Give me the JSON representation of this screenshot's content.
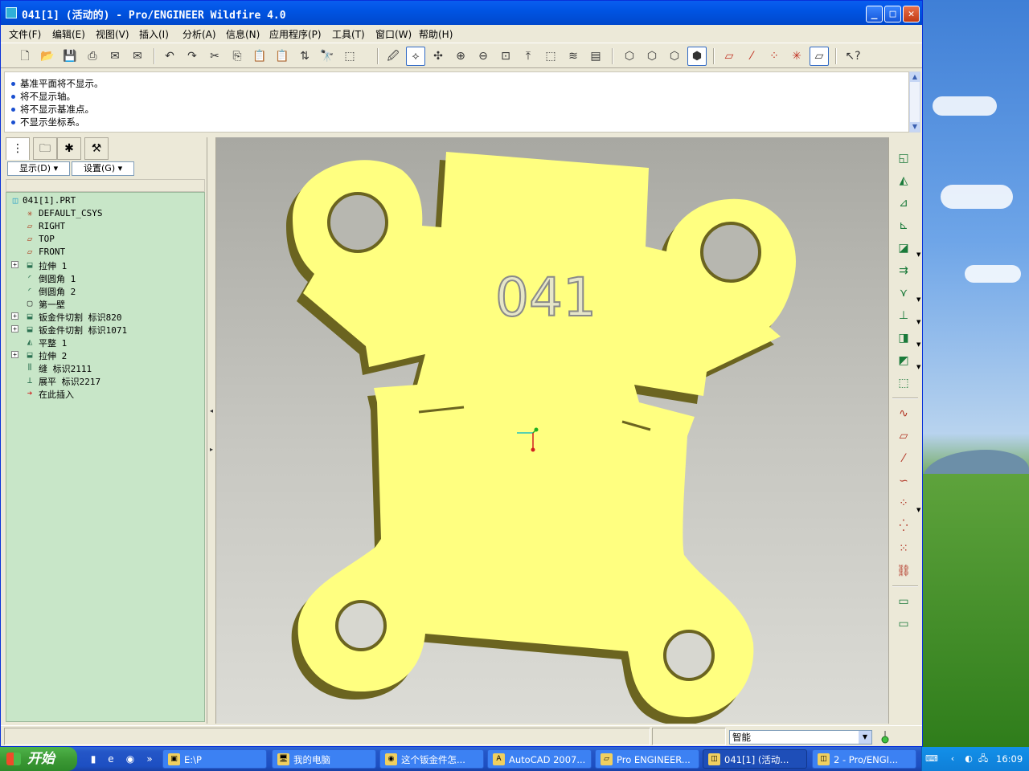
{
  "window": {
    "title": "041[1] (活动的) - Pro/ENGINEER Wildfire 4.0",
    "minimize": "_",
    "maximize": "□",
    "close": "✕"
  },
  "menus": [
    "文件(F)",
    "编辑(E)",
    "视图(V)",
    "插入(I)",
    "分析(A)",
    "信息(N)",
    "应用程序(P)",
    "工具(T)",
    "窗口(W)",
    "帮助(H)"
  ],
  "toolbar_icons": [
    "new-icon",
    "open-icon",
    "save-icon",
    "print-icon",
    "email-icon",
    "email-attach-icon",
    "undo-icon",
    "redo-icon",
    "cut-icon",
    "copy-icon",
    "paste-icon",
    "paste-special-icon",
    "regenerate-icon",
    "find-icon",
    "select-box-icon",
    "repaint-icon",
    "spin-center-icon",
    "orient-icon",
    "zoom-in-icon",
    "zoom-out-icon",
    "refit-icon",
    "reorient-icon",
    "saved-views-icon",
    "layers-icon",
    "view-manager-icon",
    "wireframe-icon",
    "hidden-line-icon",
    "no-hidden-icon",
    "shading-icon",
    "datum-planes-icon",
    "datum-axes-icon",
    "datum-points-icon",
    "csys-icon",
    "annotation-icon",
    "context-help-icon"
  ],
  "messages": [
    "基准平面将不显示。",
    "将不显示轴。",
    "将不显示基准点。",
    "不显示坐标系。"
  ],
  "navigator": {
    "show_button": "显示(D)",
    "settings_button": "设置(G)",
    "tabs": [
      "model-tree-tab",
      "folder-browser-tab",
      "favorites-tab",
      "connections-tab"
    ]
  },
  "tree": [
    {
      "label": "041[1].PRT",
      "icon": "part-icon",
      "expandable": false,
      "level": 0
    },
    {
      "label": "DEFAULT_CSYS",
      "icon": "csys-icon",
      "expandable": false,
      "level": 1
    },
    {
      "label": "RIGHT",
      "icon": "datum-plane-icon",
      "expandable": false,
      "level": 1
    },
    {
      "label": "TOP",
      "icon": "datum-plane-icon",
      "expandable": false,
      "level": 1
    },
    {
      "label": "FRONT",
      "icon": "datum-plane-icon",
      "expandable": false,
      "level": 1
    },
    {
      "label": "拉伸 1",
      "icon": "extrude-icon",
      "expandable": true,
      "level": 1
    },
    {
      "label": "倒圆角 1",
      "icon": "round-icon",
      "expandable": false,
      "level": 1
    },
    {
      "label": "倒圆角 2",
      "icon": "round-icon",
      "expandable": false,
      "level": 1
    },
    {
      "label": "第一壁",
      "icon": "wall-icon",
      "expandable": false,
      "level": 1
    },
    {
      "label": "钣金件切割 标识820",
      "icon": "sheetmetal-cut-icon",
      "expandable": true,
      "level": 1
    },
    {
      "label": "钣金件切割 标识1071",
      "icon": "sheetmetal-cut-icon",
      "expandable": true,
      "level": 1
    },
    {
      "label": "平整 1",
      "icon": "flat-wall-icon",
      "expandable": false,
      "level": 1
    },
    {
      "label": "拉伸 2",
      "icon": "extrude-icon",
      "expandable": true,
      "level": 1
    },
    {
      "label": "缝 标识2111",
      "icon": "rip-icon",
      "expandable": false,
      "level": 1
    },
    {
      "label": "展平 标识2217",
      "icon": "unbend-icon",
      "expandable": false,
      "level": 1
    },
    {
      "label": "在此插入",
      "icon": "insert-here-icon",
      "expandable": false,
      "level": 1
    }
  ],
  "model": {
    "engraved_text": "041",
    "face_color": "#ffff80",
    "edge_color": "#6b6420"
  },
  "right_toolbar_icons": [
    "flat-wall-icon",
    "flange-icon",
    "unbend-icon",
    "bend-back-icon",
    "cut-icon",
    "extrude-icon",
    "form-icon",
    "bend-icon",
    "rip-icon",
    "corner-relief-icon",
    "convert-icon",
    "datum-curve-icon",
    "datum-plane-icon",
    "datum-axis-icon",
    "sketch-curve-icon",
    "datum-point-icon",
    "offset-point-icon",
    "field-point-icon",
    "chain-icon",
    "sketch-tool-icon",
    "sketch-tool-2-icon"
  ],
  "status": {
    "filter": "智能"
  },
  "taskbar": {
    "start": "开始",
    "tasks": [
      "E:\\P",
      "我的电脑",
      "这个钣金件怎...",
      "AutoCAD 2007...",
      "Pro ENGINEER...",
      "041[1] (活动...",
      "2 - Pro/ENGI..."
    ],
    "active_task": 5,
    "clock": "16:09"
  }
}
